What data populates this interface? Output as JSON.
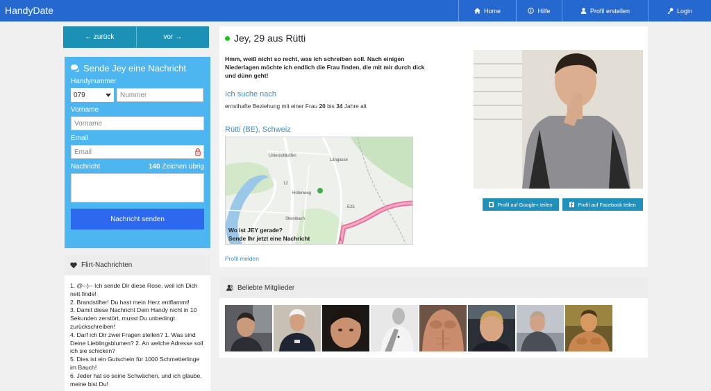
{
  "header": {
    "brand": "HandyDate",
    "nav": [
      {
        "label": "Home",
        "icon": "home-icon"
      },
      {
        "label": "Hilfe",
        "icon": "info-icon"
      },
      {
        "label": "Profil erstellen",
        "icon": "user-icon"
      },
      {
        "label": "Login",
        "icon": "key-icon"
      }
    ]
  },
  "pager": {
    "back": "← zurück",
    "next": "vor →"
  },
  "message_form": {
    "title": "Sende Jey eine Nachricht",
    "phone_label": "Handynummer",
    "prefix_value": "079",
    "number_placeholder": "Nummer",
    "firstname_label": "Vorname",
    "firstname_placeholder": "Vorname",
    "email_label": "Email",
    "email_placeholder": "Email",
    "message_label": "Nachricht",
    "chars_count": "140",
    "chars_suffix": "Zeichen übrig",
    "send_label": "Nachricht senden"
  },
  "flirt": {
    "title": "Flirt-Nachrichten",
    "lines": [
      "1. @--)-- Ich sende Dir diese Rose, weil ich Dich nett finde!",
      "2. Brandstifter! Du hast mein Herz entflammt!",
      "3. Damit diese Nachricht Dein Handy nicht in 10 Sekunden zerstört, musst Du unbedingt zurückschreiben!",
      "4. Darf ich Dir zwei Fragen stellen? 1. Was sind Deine Lieblingsblumen? 2. An welche Adresse soll ich sie schicken?",
      "5. Dies ist ein Gutschein für 1000 Schmetterlinge im Bauch!",
      "6. Jeder hat so seine Schwächen, und ich glaube, meine bist Du!"
    ]
  },
  "profile": {
    "title": "Jey, 29 aus Rütti",
    "intro": "Hmm, weiß nicht so recht, was ich schreiben soll. Nach einigen Niederlagen möchte ich endlich die Frau finden, die mit mir durch dick und dünn geht!",
    "seeking_heading": "Ich suche nach",
    "seeking_prefix": "ernsthafte Beziehung mit einer Frau",
    "age_from": "20",
    "age_between": "bis",
    "age_to": "34",
    "age_suffix": "Jahre alt",
    "location": "Rütti (BE), Schweiz",
    "map_caption_1": "Wo ist JEY gerade?",
    "map_caption_2": "Sende Ihr jetzt eine Nachricht",
    "map_labels": [
      "Unterzollikofen",
      "Steinibach",
      "Längasse",
      "Hofenweg",
      "E25",
      "12",
      "1"
    ],
    "report": "Profil melden",
    "share_google": "Profil auf Google+ teilen",
    "share_facebook": "Profil auf Facebook teilen"
  },
  "members": {
    "title": "Beliebte Mitglieder",
    "count_shown": 8
  },
  "colors": {
    "navbar": "#2468d0",
    "form": "#4db5ef",
    "send": "#2d69ee",
    "pager": "#1c91b6",
    "link": "#3b8bc2",
    "online": "#1fc31f"
  }
}
